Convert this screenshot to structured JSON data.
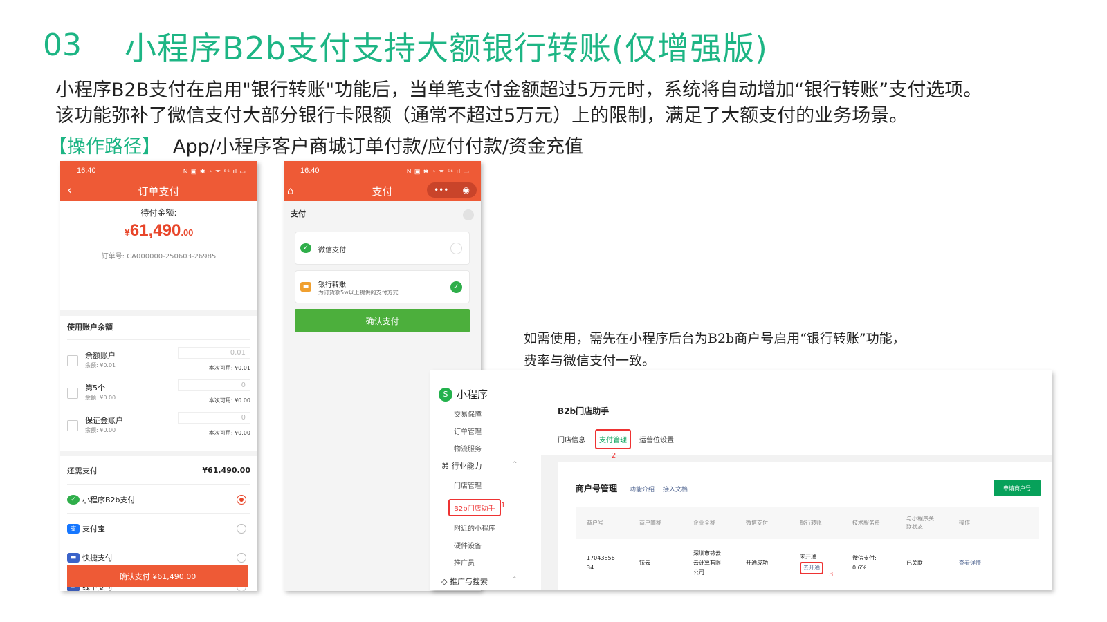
{
  "slide": {
    "number": "03",
    "title": "小程序B2b支付支持大额银行转账(仅增强版)",
    "desc_line1": "小程序B2B支付在启用\"银行转账\"功能后，当单笔支付金额超过5万元时，系统将自动增加“银行转账”支付选项。",
    "desc_line2": "该功能弥补了微信支付大部分银行卡限额（通常不超过5万元）上的限制，满足了大额支付的业务场景。",
    "path_label": "【操作路径】",
    "path_value": "App/小程序客户商城订单付款/应付付款/资金充值",
    "note_line1": "如需使用，需先在小程序后台为B2b商户号启用“银行转账”功能，",
    "note_line2": "费率与微信支付一致。"
  },
  "phone1": {
    "time": "16:40",
    "status_icons": "N ▣ ✱ ◔ ᯤ ⁵⁶ ıl ▭",
    "back": "‹",
    "title": "订单支付",
    "amount_label": "待付金额:",
    "amount_currency": "¥",
    "amount_int": "61,490",
    "amount_dec": ".00",
    "order_no": "订单号: CA000000-250603-26985",
    "balance_title": "使用账户余额",
    "accounts": [
      {
        "name": "余额账户",
        "balance": "余额: ¥0.01",
        "input": "0.01",
        "available": "本次可用: ¥0.01"
      },
      {
        "name": "第5个",
        "balance": "余额: ¥0.00",
        "input": "0",
        "available": "本次可用: ¥0.00"
      },
      {
        "name": "保证金账户",
        "balance": "余额: ¥0.00",
        "input": "0",
        "available": "本次可用: ¥0.00"
      }
    ],
    "remain_label": "还需支付",
    "remain_amount": "¥61,490.00",
    "methods": [
      {
        "name": "小程序B2b支付",
        "icon": "wechat-pay-icon",
        "selected": true
      },
      {
        "name": "支付宝",
        "icon": "alipay-icon",
        "selected": false
      },
      {
        "name": "快捷支付",
        "icon": "card-icon",
        "selected": false
      },
      {
        "name": "线下支付",
        "icon": "wallet-icon",
        "selected": false
      }
    ],
    "confirm": "确认支付 ¥61,490.00"
  },
  "phone2": {
    "time": "16:40",
    "status_icons": "N ▣ ✱ ◔ ᯤ ⁵⁶ ıl ▭",
    "home": "⌂",
    "title": "支付",
    "capsule_more": "•••",
    "capsule_close": "◉",
    "sheet_title": "支付",
    "options": [
      {
        "name": "微信支付",
        "sub": "",
        "selected": false
      },
      {
        "name": "银行转账",
        "sub": "为订货额5w以上提供的支付方式",
        "selected": true
      }
    ],
    "check": "✓",
    "confirm": "确认支付"
  },
  "admin": {
    "logo": "小程序",
    "logo_glyph": "S",
    "sidebar": {
      "items_top": [
        "交易保障",
        "订单管理",
        "物流服务"
      ],
      "group1": "行业能力",
      "group1_caret": "^",
      "items_mid": [
        "门店管理",
        "B2b门店助手",
        "附近的小程序",
        "硬件设备",
        "推广员"
      ],
      "group2": "推广与搜索",
      "group2_caret": "^"
    },
    "page_title": "B2b门店助手",
    "tabs": [
      "门店信息",
      "支付管理",
      "运营位设置"
    ],
    "panel_title": "商户号管理",
    "panel_links": [
      "功能介绍",
      "接入文档"
    ],
    "apply_button": "申请商户号",
    "columns": [
      "商户号",
      "商户简称",
      "企业全称",
      "微信支付",
      "银行转账",
      "技术服务费",
      "与小程序关联状态",
      "操作"
    ],
    "row": {
      "merchant_no": "17043856 34",
      "short_name": "铱云",
      "full_name": "深圳市铱云云计算有限公司",
      "wechat_pay": "开通成功",
      "bank_status": "未开通",
      "bank_action": "去开通",
      "service_fee": "微信支付: 0.6%",
      "link_status": "已关联",
      "op": "查看详情"
    },
    "markers": [
      "1",
      "2",
      "3"
    ]
  }
}
